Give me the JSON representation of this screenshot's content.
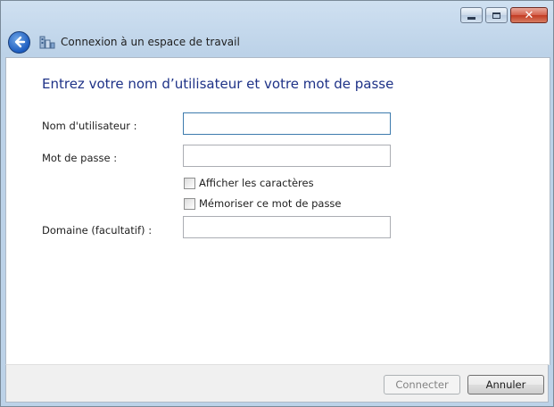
{
  "window": {
    "title": "Connexion à un espace de travail",
    "caption_icons": [
      "minimize-icon",
      "maximize-icon",
      "close-icon"
    ],
    "close_glyph": "✕"
  },
  "form": {
    "heading": "Entrez votre nom d’utilisateur et votre mot de passe",
    "username_label": "Nom d'utilisateur :",
    "username_value": "",
    "password_label": "Mot de passe :",
    "password_value": "",
    "show_chars_label": "Afficher les caractères",
    "show_chars_checked": false,
    "remember_label": "Mémoriser ce mot de passe",
    "remember_checked": false,
    "domain_label": "Domaine (facultatif) :",
    "domain_value": ""
  },
  "footer": {
    "connect_label": "Connecter",
    "connect_enabled": false,
    "cancel_label": "Annuler"
  },
  "colors": {
    "heading": "#1e3287",
    "accent": "#1c5cc0",
    "close_button": "#c23a22"
  }
}
